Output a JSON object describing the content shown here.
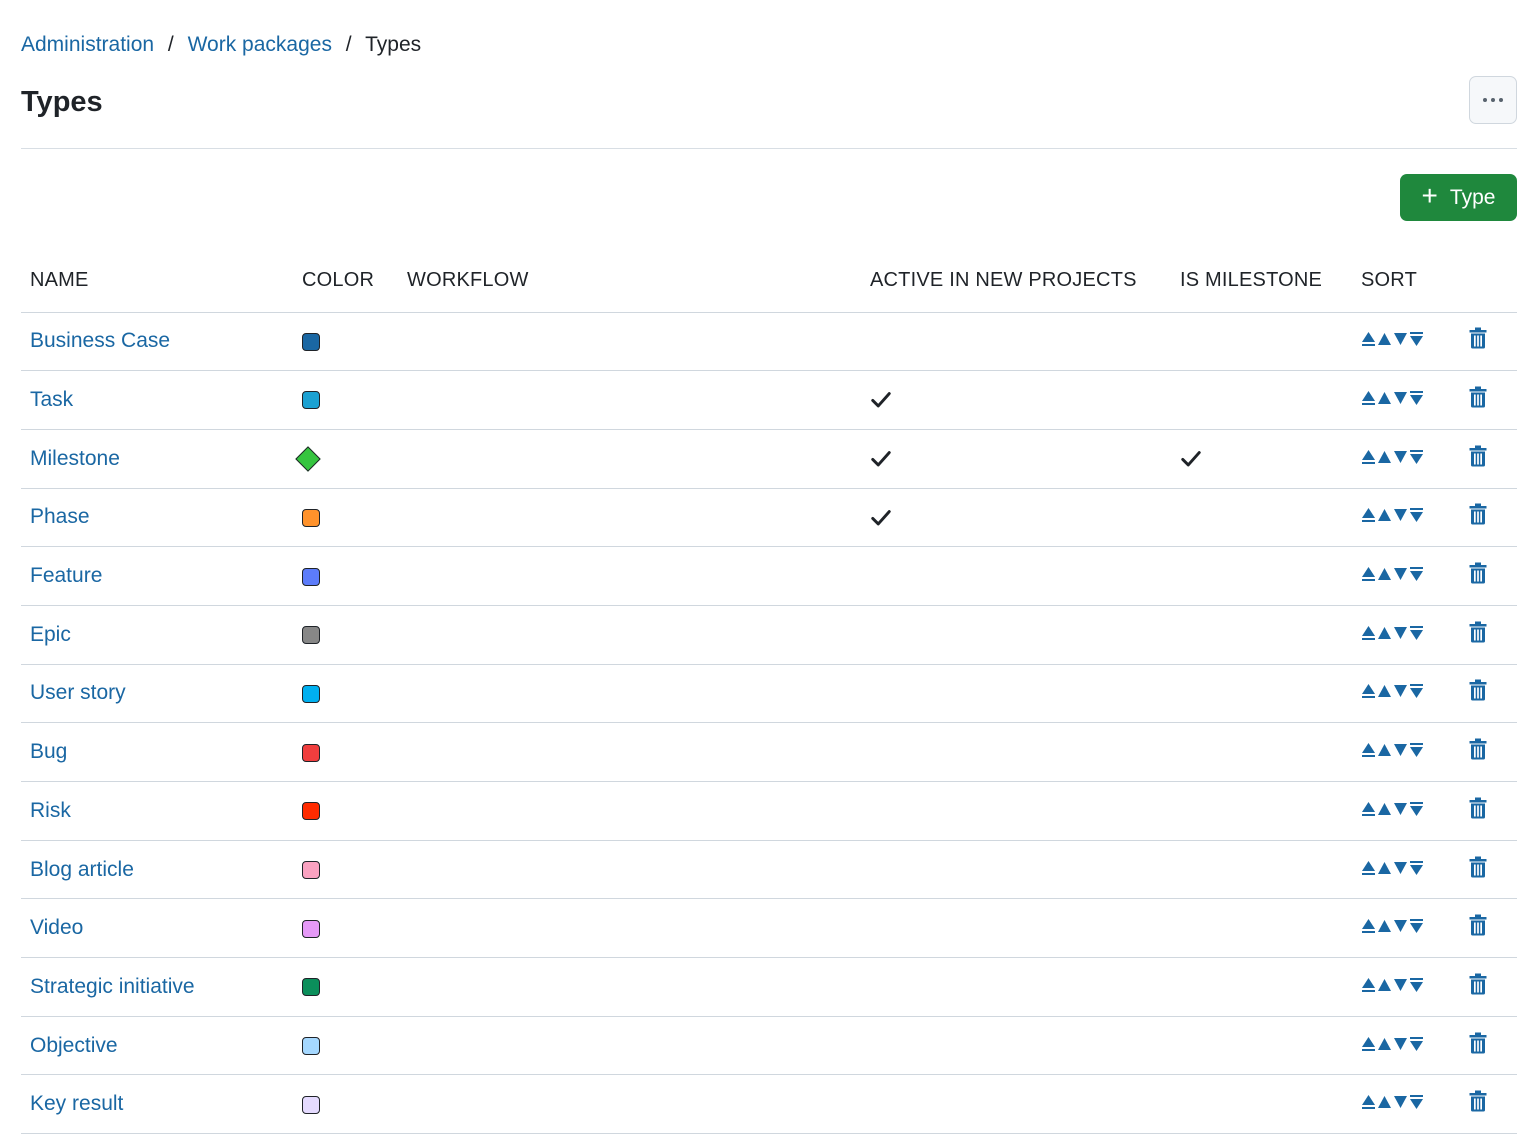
{
  "breadcrumb": {
    "items": [
      {
        "label": "Administration"
      },
      {
        "label": "Work packages"
      }
    ],
    "separator": "/",
    "current": "Types"
  },
  "page": {
    "title": "Types"
  },
  "actions": {
    "add_type_label": "Type",
    "more_icon": "kebab-horizontal-icon"
  },
  "table": {
    "columns": {
      "name": "NAME",
      "color": "COLOR",
      "workflow": "WORKFLOW",
      "active": "ACTIVE IN NEW PROJECTS",
      "milestone": "IS MILESTONE",
      "sort": "SORT"
    },
    "rows": [
      {
        "name": "Business Case",
        "color": "#1A67A3",
        "shape": "square",
        "active": false,
        "is_milestone": false
      },
      {
        "name": "Task",
        "color": "#1BA1D2",
        "shape": "square",
        "active": true,
        "is_milestone": false
      },
      {
        "name": "Milestone",
        "color": "#35C53F",
        "shape": "diamond",
        "active": true,
        "is_milestone": true
      },
      {
        "name": "Phase",
        "color": "#FF922B",
        "shape": "square",
        "active": true,
        "is_milestone": false
      },
      {
        "name": "Feature",
        "color": "#5C7CFA",
        "shape": "square",
        "active": false,
        "is_milestone": false
      },
      {
        "name": "Epic",
        "color": "#878787",
        "shape": "square",
        "active": false,
        "is_milestone": false
      },
      {
        "name": "User story",
        "color": "#00B0F0",
        "shape": "square",
        "active": false,
        "is_milestone": false
      },
      {
        "name": "Bug",
        "color": "#F03E3E",
        "shape": "square",
        "active": false,
        "is_milestone": false
      },
      {
        "name": "Risk",
        "color": "#FF2B00",
        "shape": "square",
        "active": false,
        "is_milestone": false
      },
      {
        "name": "Blog article",
        "color": "#FAA2C1",
        "shape": "square",
        "active": false,
        "is_milestone": false
      },
      {
        "name": "Video",
        "color": "#E599F7",
        "shape": "square",
        "active": false,
        "is_milestone": false
      },
      {
        "name": "Strategic initiative",
        "color": "#0B8F5B",
        "shape": "square",
        "active": false,
        "is_milestone": false
      },
      {
        "name": "Objective",
        "color": "#A5D8FF",
        "shape": "square",
        "active": false,
        "is_milestone": false
      },
      {
        "name": "Key result",
        "color": "#E5DBFF",
        "shape": "square",
        "active": false,
        "is_milestone": false
      }
    ]
  },
  "icons": {
    "sort": [
      "move-to-top-icon",
      "move-up-icon",
      "move-down-icon",
      "move-to-bottom-icon"
    ],
    "delete": "trash-icon",
    "check": "check-icon"
  },
  "colors": {
    "link": "#1A67A3",
    "primary_button": "#1F883D",
    "border": "#D0D7DE"
  }
}
